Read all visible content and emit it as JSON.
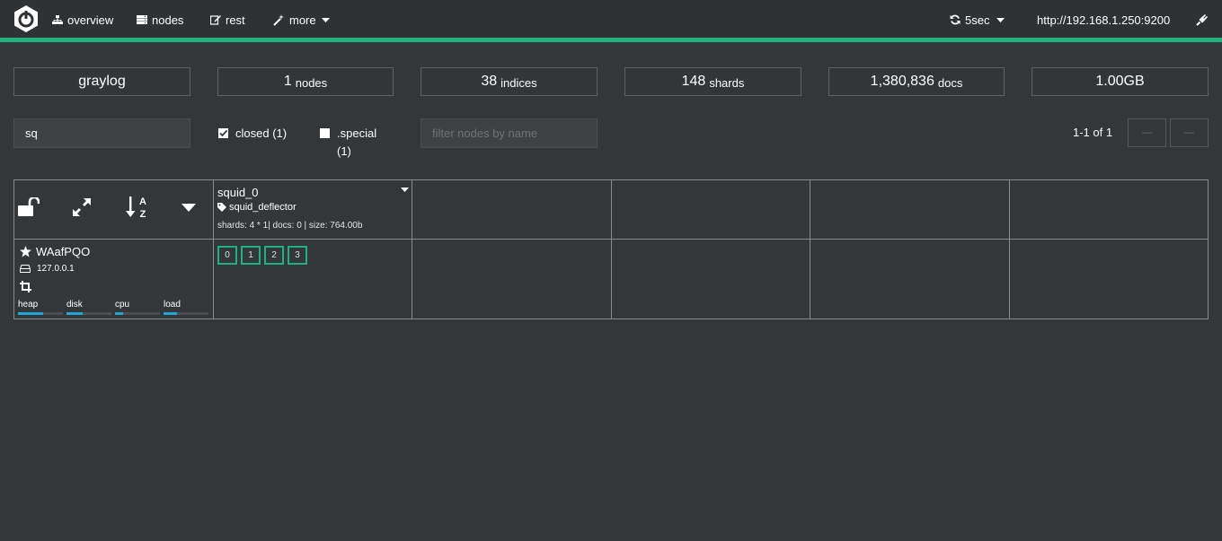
{
  "nav": {
    "overview": "overview",
    "nodes": "nodes",
    "rest": "rest",
    "more": "more",
    "refresh": "5sec",
    "host": "http://192.168.1.250:9200"
  },
  "stats": {
    "cluster_name": "graylog",
    "nodes_count": "1",
    "nodes_label": "nodes",
    "indices_count": "38",
    "indices_label": "indices",
    "shards_count": "148",
    "shards_label": "shards",
    "docs_count": "1,380,836",
    "docs_label": "docs",
    "size": "1.00GB"
  },
  "filters": {
    "index_filter_value": "sq",
    "closed_label": "closed (1)",
    "closed_checked": true,
    "special_label": ".special",
    "special_count": "(1)",
    "special_checked": false,
    "node_filter_placeholder": "filter nodes by name"
  },
  "pager": {
    "text": "1-1 of 1",
    "prev": "—",
    "next": "—"
  },
  "index": {
    "name": "squid_0",
    "alias": "squid_deflector",
    "meta": "shards: 4 * 1| docs: 0 | size: 764.00b"
  },
  "node": {
    "name": "WAafPQO",
    "ip": "127.0.0.1",
    "metrics": [
      {
        "label": "heap",
        "fill": 0.55
      },
      {
        "label": "disk",
        "fill": 0.35
      },
      {
        "label": "cpu",
        "fill": 0.18
      },
      {
        "label": "load",
        "fill": 0.3
      }
    ]
  },
  "shards": [
    "0",
    "1",
    "2",
    "3"
  ],
  "colors": {
    "accent": "#1fb27f",
    "background": "#34373a",
    "metric": "#1ea7d8"
  }
}
